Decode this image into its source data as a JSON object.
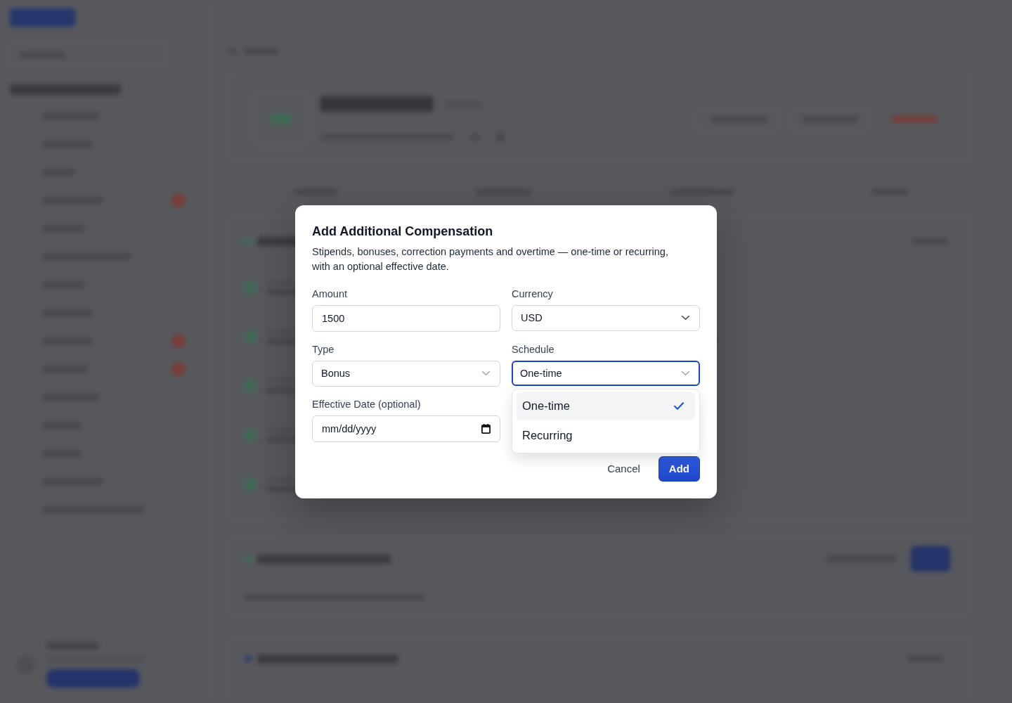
{
  "dialog": {
    "title": "Add Additional Compensation",
    "description": "Stipends, bonuses, correction payments and overtime — one-time or recurring, with an optional effective date.",
    "fields": [
      {
        "kind": "input",
        "label": "Amount",
        "value": "1500"
      },
      {
        "kind": "select",
        "label": "Currency",
        "value": "USD",
        "expanded": false
      },
      {
        "kind": "select",
        "label": "Type",
        "value": "Bonus",
        "expanded": false
      },
      {
        "kind": "select",
        "label": "Schedule",
        "value": "One-time",
        "expanded": true,
        "options": [
          {
            "label": "One-time",
            "selected": true
          },
          {
            "label": "Recurring",
            "selected": false
          }
        ]
      },
      {
        "kind": "date",
        "label": "Effective Date (optional)",
        "placeholder": "mm/dd/yyyy"
      }
    ],
    "buttons": [
      {
        "kind": "secondary",
        "label": "Cancel"
      },
      {
        "kind": "primary",
        "label": "Add"
      }
    ]
  }
}
